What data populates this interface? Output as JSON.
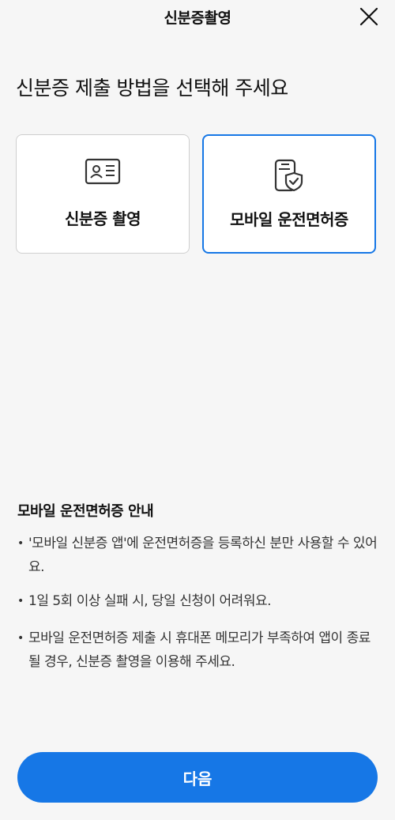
{
  "header": {
    "title": "신분증촬영"
  },
  "heading": "신분증 제출 방법을 선택해 주세요",
  "options": [
    {
      "label": "신분증 촬영",
      "icon": "id-card-icon",
      "selected": false
    },
    {
      "label": "모바일 운전면허증",
      "icon": "mobile-shield-icon",
      "selected": true
    }
  ],
  "notice": {
    "title": "모바일 운전면허증 안내",
    "items": [
      "'모바일 신분증 앱'에 운전면허증을 등록하신 분만 사용할 수 있어요.",
      "1일 5회 이상 실패 시, 당일 신청이 어려워요.",
      "모바일 운전면허증 제출 시 휴대폰 메모리가 부족하여 앱이 종료될 경우, 신분증 촬영을 이용해 주세요."
    ]
  },
  "next_button": "다음",
  "colors": {
    "accent": "#1677e6",
    "background": "#f6f6f6"
  }
}
